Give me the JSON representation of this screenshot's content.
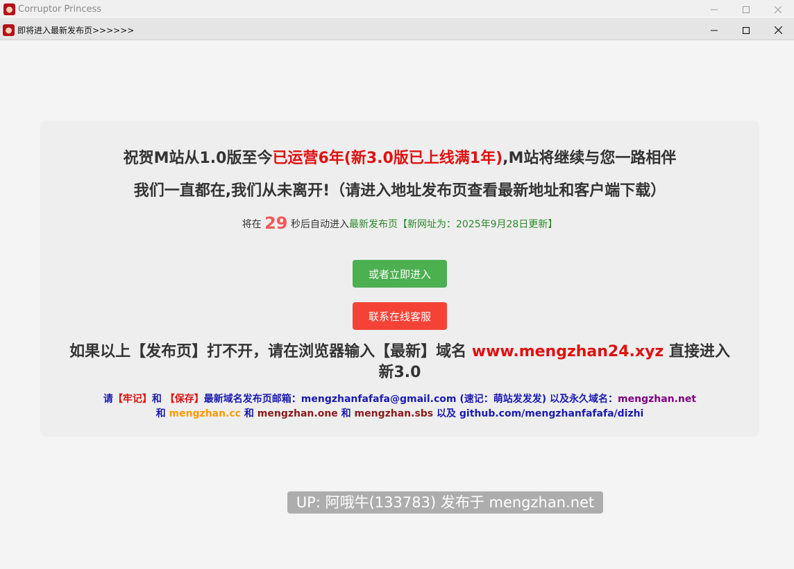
{
  "outer_window": {
    "title": "Corruptor Princess",
    "controls": {
      "minimize": "—",
      "maximize": "☐",
      "close": "✕"
    }
  },
  "inner_window": {
    "title": "即将进入最新发布页>>>>>>",
    "controls": {
      "minimize": "—",
      "maximize": "☐",
      "close": "✕"
    }
  },
  "card": {
    "headline1_a": "祝贺M站从1.0版至今",
    "headline1_b": "已运营6年(新3.0版已上线满1年)",
    "headline1_c": ",M站将继续与您一路相伴",
    "headline2": "我们一直都在,我们从未离开!（请进入地址发布页查看最新地址和客户端下载）",
    "countdown_prefix": "将在",
    "countdown_value": "29",
    "countdown_suffix": "秒后自动进入",
    "countdown_target": "最新发布页【新网址为：2025年9月28日更新】",
    "enter_button": "或者立即进入",
    "service_button": "联系在线客服",
    "fallback_a": "如果以上【发布页】打不开，请在浏览器输入【最新】域名",
    "fallback_domain": "www.mengzhan24.xyz",
    "fallback_b": "直接进入新3.0",
    "email": {
      "please": "请",
      "remember": "【牢记】",
      "and1": "和",
      "save": "【保存】",
      "mailbox_text": "最新域名发布页邮箱：mengzhanfafafa@gmail.com (速记：萌站发发发) 以及永久域名：",
      "domain_net": "mengzhan.net",
      "and2": "和",
      "domain_cc": "mengzhan.cc",
      "and3": "和",
      "domain_one": "mengzhan.one",
      "and4": "和",
      "domain_sbs": "mengzhan.sbs",
      "and5": "以及",
      "github": "github.com/mengzhanfafafa/dizhi"
    }
  },
  "watermark": "UP: 阿哦牛(133783) 发布于 mengzhan.net",
  "colors": {
    "accent_red": "#e01010",
    "button_green": "#4caf50",
    "button_red": "#f44336",
    "link_blue": "#1a1ab0"
  }
}
